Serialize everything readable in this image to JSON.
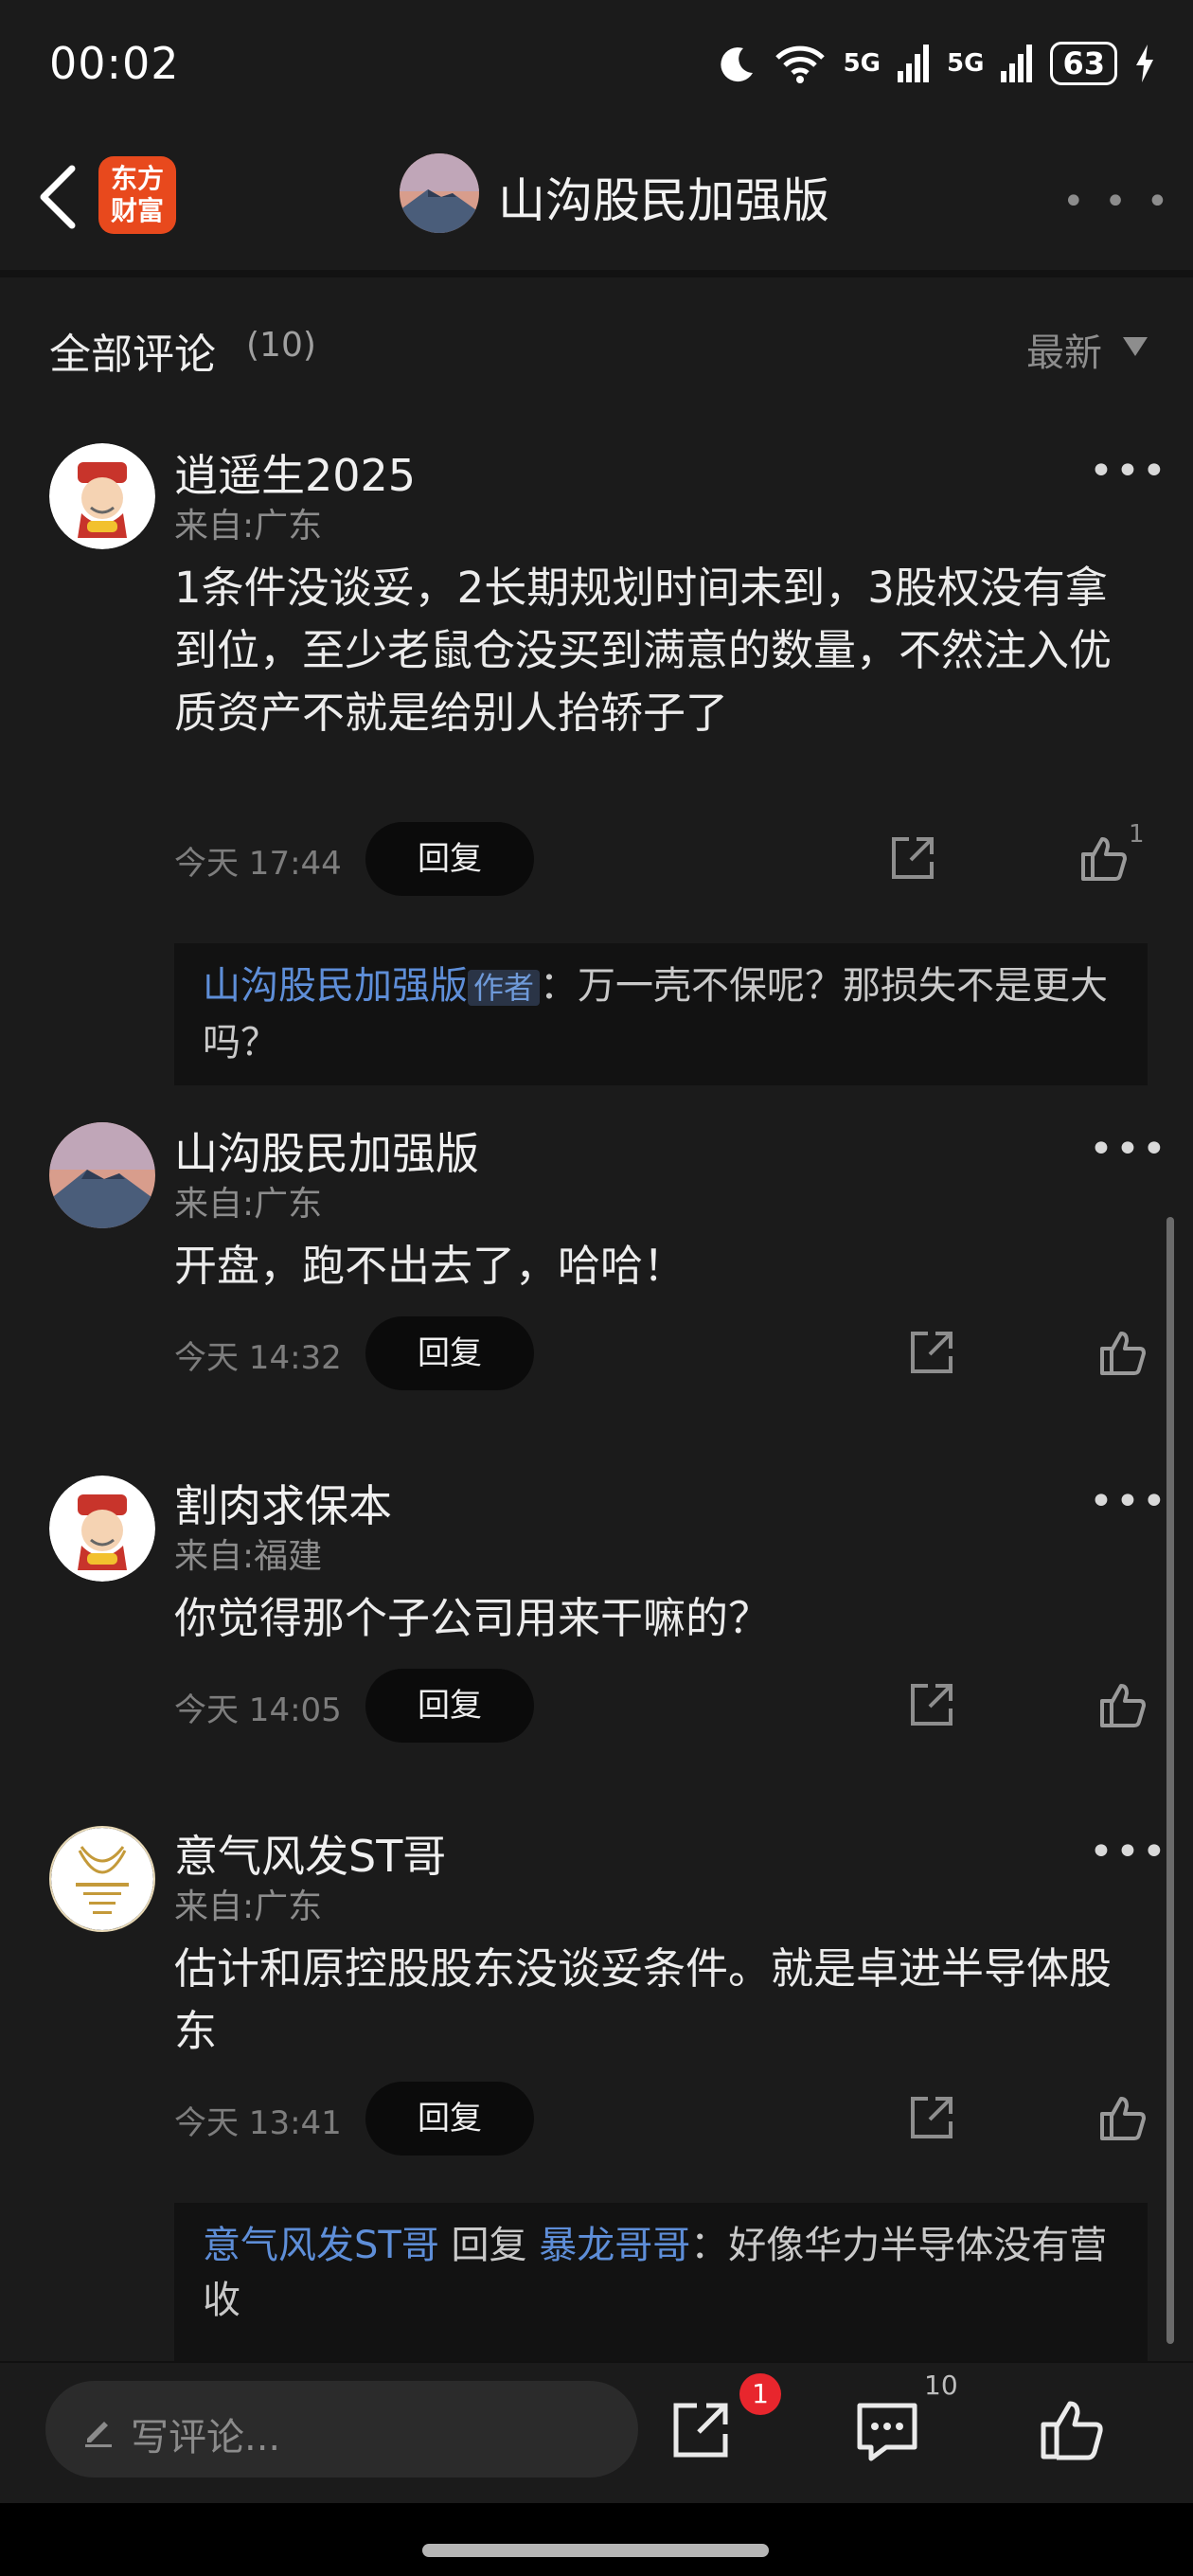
{
  "status_bar": {
    "time": "00:02",
    "signal1": "5G",
    "signal2": "5G",
    "battery": "63"
  },
  "header": {
    "logo_line1": "东方",
    "logo_line2": "财富",
    "title": "山沟股民加强版"
  },
  "comments_header": {
    "label": "全部评论",
    "count": "(10)",
    "sort": "最新"
  },
  "comments": [
    {
      "username": "逍遥生2025",
      "location": "来自:广东",
      "text": "1条件没谈妥，2长期规划时间未到，3股权没有拿到位，至少老鼠仓没买到满意的数量，不然注入优质资产不就是给别人抬轿子了",
      "time": "今天 17:44",
      "reply_label": "回复",
      "likes": "1",
      "sub_reply": {
        "author": "山沟股民加强版",
        "author_badge": "作者",
        "separator": "：",
        "text": "万一壳不保呢？那损失不是更大吗？"
      }
    },
    {
      "username": "山沟股民加强版",
      "location": "来自:广东",
      "text": "开盘，跑不出去了，哈哈！",
      "time": "今天 14:32",
      "reply_label": "回复"
    },
    {
      "username": "割肉求保本",
      "location": "来自:福建",
      "text": "你觉得那个子公司用来干嘛的？",
      "time": "今天 14:05",
      "reply_label": "回复"
    },
    {
      "username": "意气风发ST哥",
      "location": "来自:广东",
      "text": "估计和原控股股东没谈妥条件。就是卓进半导体股东",
      "time": "今天 13:41",
      "reply_label": "回复",
      "sub_reply": {
        "author": "意气风发ST哥",
        "reply_word": "回复",
        "target": "暴龙哥哥",
        "separator": "：",
        "text": "好像华力半导体没有营收"
      }
    }
  ],
  "bottom_bar": {
    "placeholder": "写评论...",
    "share_badge": "1",
    "comment_count": "10"
  },
  "colors": {
    "background": "#1b1b1b",
    "link": "#5e8ed8",
    "logo": "#e8491d",
    "badge": "#e8262d"
  }
}
